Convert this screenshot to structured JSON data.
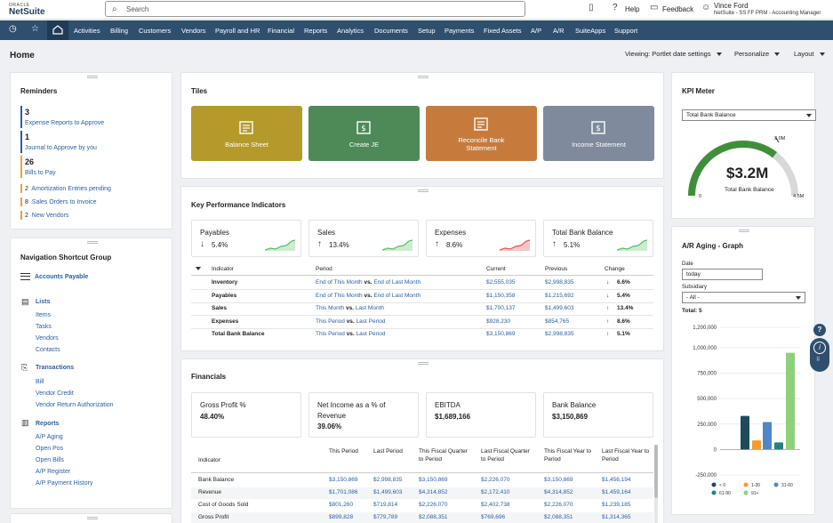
{
  "brand": {
    "oracle": "ORACLE",
    "name": "NetSuite"
  },
  "search": {
    "placeholder": "Search"
  },
  "topbar": {
    "help": "Help",
    "feedback": "Feedback"
  },
  "user": {
    "name": "Vince Ford",
    "role": "NetSuite - SS FF PRM - Accounting Manager"
  },
  "nav": [
    "Activities",
    "Billing",
    "Customers",
    "Vendors",
    "Payroll and HR",
    "Financial",
    "Reports",
    "Analytics",
    "Documents",
    "Setup",
    "Payments",
    "Fixed Assets",
    "A/P",
    "A/R",
    "SuiteApps",
    "Support"
  ],
  "page": {
    "title": "Home",
    "viewing": "Viewing: Portlet date settings",
    "personalize": "Personalize",
    "layout": "Layout"
  },
  "reminders": {
    "title": "Reminders",
    "items": [
      {
        "count": "3",
        "label": "Expense Reports to Approve"
      },
      {
        "count": "1",
        "label": "Journal to Approve by you"
      },
      {
        "count": "26",
        "label": "Bills to Pay"
      }
    ],
    "small": [
      {
        "count": "2",
        "label": "Amortization Entries pending"
      },
      {
        "count": "8",
        "label": "Sales Orders to Invoice"
      },
      {
        "count": "2",
        "label": "New Vendors"
      }
    ]
  },
  "navgroup": {
    "title": "Navigation Shortcut Group",
    "top": "Accounts Payable",
    "lists": {
      "head": "Lists",
      "items": [
        "Items",
        "Tasks",
        "Vendors",
        "Contacts"
      ]
    },
    "transactions": {
      "head": "Transactions",
      "items": [
        "Bill",
        "Vendor Credit",
        "Vendor Return Authorization"
      ]
    },
    "reports": {
      "head": "Reports",
      "items": [
        "A/P Aging",
        "Open Pos",
        "Open Bills",
        "A/P Register",
        "A/P Payment History"
      ]
    }
  },
  "tiles": {
    "title": "Tiles",
    "items": [
      {
        "label": "Balance Sheet",
        "color": "#b49a2a"
      },
      {
        "label": "Create JE",
        "color": "#4d8a57"
      },
      {
        "label": "Reconcile Bank Statement",
        "color": "#c67b3d"
      },
      {
        "label": "Income Statement",
        "color": "#7f8a9c"
      }
    ]
  },
  "kpi": {
    "title": "Key Performance Indicators",
    "boxes": [
      {
        "name": "Payables",
        "arrow": "↓",
        "value": "5.4%",
        "trend": "up"
      },
      {
        "name": "Sales",
        "arrow": "↑",
        "value": "13.4%",
        "trend": "up"
      },
      {
        "name": "Expenses",
        "arrow": "↑",
        "value": "8.6%",
        "trend": "down"
      },
      {
        "name": "Total Bank Balance",
        "arrow": "↑",
        "value": "5.1%",
        "trend": "up"
      }
    ],
    "headers": {
      "indicator": "Indicator",
      "period": "Period",
      "current": "Current",
      "previous": "Previous",
      "change": "Change"
    },
    "rows": [
      {
        "indicator": "Inventory",
        "p1": "End of This Month",
        "vs": "vs.",
        "p2": "End of Last Month",
        "current": "$2,555,035",
        "previous": "$2,998,835",
        "arrow": "↓",
        "change": "6.6%"
      },
      {
        "indicator": "Payables",
        "p1": "End of This Month",
        "vs": "vs.",
        "p2": "End of Last Month",
        "current": "$1,150,358",
        "previous": "$1,215,692",
        "arrow": "↓",
        "change": "5.4%"
      },
      {
        "indicator": "Sales",
        "p1": "This Month",
        "vs": "vs.",
        "p2": "Last Month",
        "current": "$1,700,137",
        "previous": "$1,499,603",
        "arrow": "↑",
        "change": "13.4%"
      },
      {
        "indicator": "Expenses",
        "p1": "This Period",
        "vs": "vs.",
        "p2": "Last Period",
        "current": "$928,230",
        "previous": "$854,765",
        "arrow": "↑",
        "change": "8.6%"
      },
      {
        "indicator": "Total Bank Balance",
        "p1": "This Period",
        "vs": "vs.",
        "p2": "Last Period",
        "current": "$3,150,869",
        "previous": "$2,998,835",
        "arrow": "↑",
        "change": "5.1%"
      }
    ]
  },
  "financials": {
    "title": "Financials",
    "boxes": [
      {
        "name": "Gross Profit %",
        "value": "48.40%"
      },
      {
        "name": "Net Income as a % of Revenue",
        "value": "39.06%"
      },
      {
        "name": "EBITDA",
        "value": "$1,689,166"
      },
      {
        "name": "Bank Balance",
        "value": "$3,150,869"
      }
    ],
    "headers": [
      "Indicator",
      "This Period",
      "Last Period",
      "This Fiscal Quarter to Period",
      "Last Fiscal Quarter to Period",
      "This Fiscal Year to Period",
      "Last Fiscal Year to Period"
    ],
    "rows": [
      {
        "name": "Bank Balance",
        "vals": [
          "$3,150,869",
          "$2,998,835",
          "$3,150,869",
          "$2,226,070",
          "$3,150,869",
          "$1,456,194"
        ]
      },
      {
        "name": "Revenue",
        "vals": [
          "$1,701,086",
          "$1,499,603",
          "$4,314,852",
          "$2,172,410",
          "$4,314,852",
          "$1,459,164"
        ]
      },
      {
        "name": "Cost of Goods Sold",
        "vals": [
          "$801,260",
          "$719,814",
          "$2,226,070",
          "$2,402,738",
          "$2,226,070",
          "$1,239,185"
        ]
      },
      {
        "name": "Gross Profit",
        "vals": [
          "$899,828",
          "$779,789",
          "$2,088,351",
          "$769,696",
          "$2,088,351",
          "$1,314,365"
        ]
      }
    ]
  },
  "kpimeter": {
    "title": "KPI Meter",
    "select": "Total Bank Balance",
    "value": "$3.2M",
    "label": "Total Bank Balance",
    "min": "0",
    "mid": "3.0M",
    "max": "4.5M",
    "fraction": 0.71
  },
  "aging": {
    "title": "A/R Aging - Graph",
    "date_label": "Date",
    "date_value": "today",
    "subsidiary_label": "Subsidiary",
    "subsidiary_value": "- All -",
    "total": "Total: 5"
  },
  "chart_data": {
    "type": "bar",
    "title": "",
    "xlabel": "",
    "ylabel": "",
    "ylim": [
      -250000,
      1200000
    ],
    "ticks": [
      "1,200,000",
      "1,000,000",
      "750,000",
      "500,000",
      "250,000",
      "0",
      "-250,000"
    ],
    "categories": [
      "< 0",
      "1-30",
      "31-60",
      "61-90",
      "91+"
    ],
    "colors": [
      "#1e4a5c",
      "#f39c2c",
      "#4f86c6",
      "#2a7f7a",
      "#8fd07a"
    ],
    "values": [
      330000,
      90000,
      270000,
      70000,
      950000
    ],
    "legend": [
      "< 0",
      "1-30",
      "31-60",
      "61-90",
      "91+"
    ]
  }
}
